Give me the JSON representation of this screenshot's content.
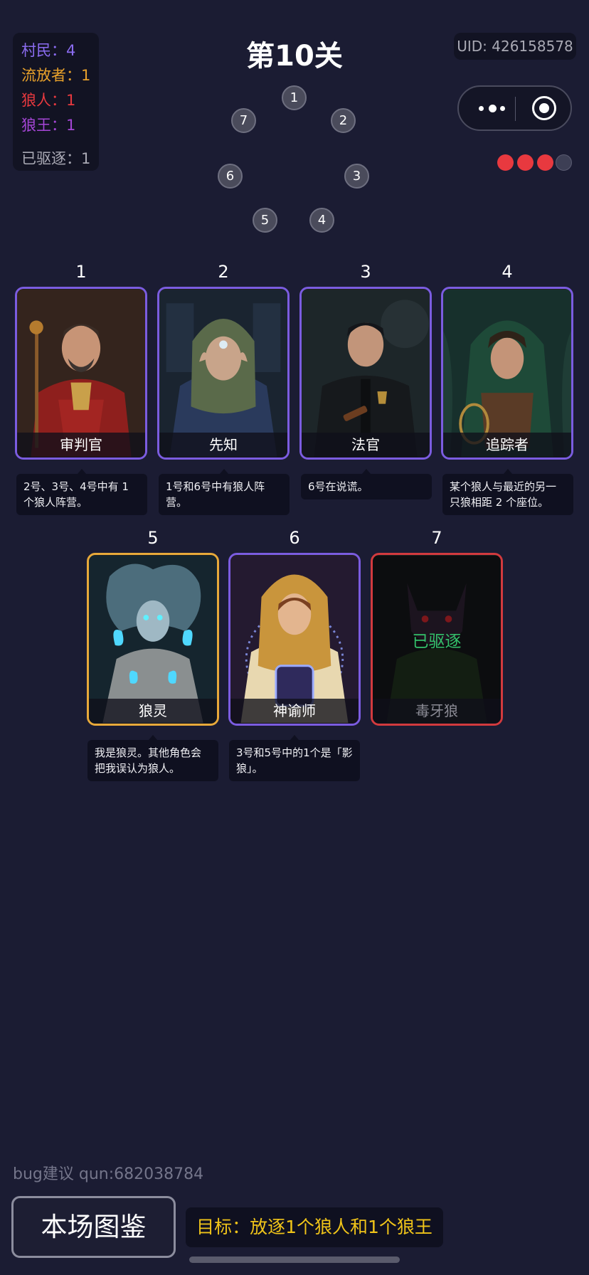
{
  "stats": {
    "villager": {
      "label": "村民：4",
      "color": "#8b6cf0"
    },
    "exile": {
      "label": "流放者：1",
      "color": "#e8a12b"
    },
    "werewolf": {
      "label": "狼人：1",
      "color": "#e8393f"
    },
    "wolf_king": {
      "label": "狼王：1",
      "color": "#a546d6"
    },
    "evicted": {
      "label": "已驱逐：1",
      "color": "#a9a9b4"
    }
  },
  "title": "第10关",
  "uid": "UID: 426158578",
  "capsule": {
    "more_icon": "more-dots-icon",
    "close_icon": "target-icon"
  },
  "lives": {
    "filled": 3,
    "total": 4
  },
  "seats": [
    "1",
    "2",
    "3",
    "4",
    "5",
    "6",
    "7"
  ],
  "cards": [
    {
      "num": "1",
      "name": "审判官",
      "clue": "2号、3号、4号中有 1 个狼人阵营。",
      "border": "purple"
    },
    {
      "num": "2",
      "name": "先知",
      "clue": "1号和6号中有狼人阵营。",
      "border": "purple"
    },
    {
      "num": "3",
      "name": "法官",
      "clue": "6号在说谎。",
      "border": "purple"
    },
    {
      "num": "4",
      "name": "追踪者",
      "clue": "某个狼人与最近的另一只狼相距 2 个座位。",
      "border": "purple"
    },
    {
      "num": "5",
      "name": "狼灵",
      "clue": "我是狼灵。其他角色会把我误认为狼人。",
      "border": "gold"
    },
    {
      "num": "6",
      "name": "神谕师",
      "clue": "3号和5号中的1个是「影狼」。",
      "border": "purple"
    },
    {
      "num": "7",
      "name": "毒牙狼",
      "status": "已驱逐",
      "border": "red"
    }
  ],
  "bug_text": "bug建议 qun:682038784",
  "guide_button": "本场图鉴",
  "goal": "目标：放逐1个狼人和1个狼王"
}
